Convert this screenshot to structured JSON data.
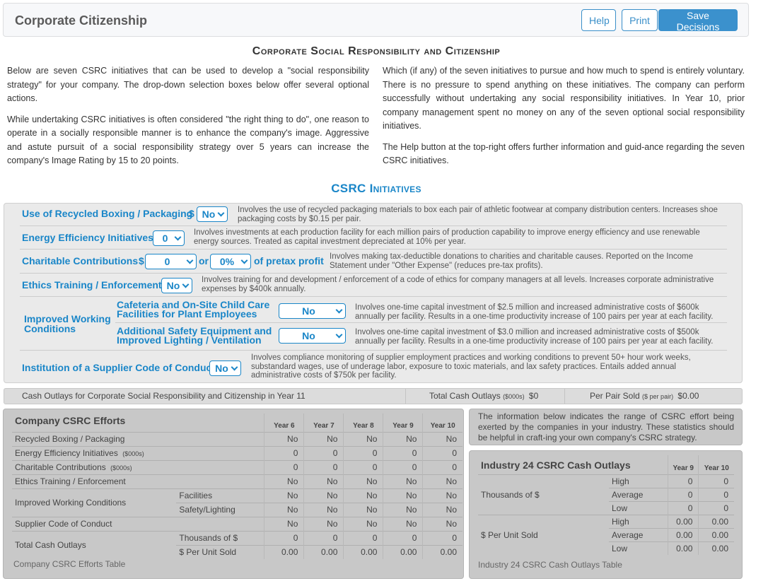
{
  "header": {
    "title": "Corporate Citizenship",
    "buttons": {
      "help": "Help",
      "print": "Print",
      "save": "Save Decisions"
    }
  },
  "main_title": "Corporate Social Responsibility and Citizenship",
  "intro": {
    "left": [
      "Below are seven CSRC initiatives that can be used to develop a \"social responsibility strategy\" for your company. The drop-down selection boxes below offer several optional actions.",
      "While undertaking CSRC initiatives is often considered \"the right thing to do\", one reason to operate in a socially responsible manner is to enhance the company's image. Aggressive and astute pursuit of a social responsibility strategy over 5 years can increase the company's Image Rating by 15 to 20 points."
    ],
    "right": [
      "Which (if any) of the seven initiatives to pursue and how much to spend is entirely voluntary. There is no pressure to spend anything on these initiatives. The company can perform successfully without undertaking any social responsibility initiatives. In Year 10, prior company management spent no money on any of the seven optional social responsibility initiatives.",
      "The Help button at the top-right offers further information and guid-ance regarding the seven CSRC initiatives."
    ]
  },
  "initiatives_title": "CSRC Initiatives",
  "initiatives": {
    "recycled": {
      "label": "Use of Recycled Boxing / Packaging",
      "prefix": "$",
      "value": "No",
      "desc": "Involves the use of recycled packaging materials to box each pair of athletic footwear at company distribution centers. Increases shoe packaging costs by $0.15 per pair."
    },
    "energy": {
      "label": "Energy Efficiency Initiatives",
      "value": "0",
      "desc": "Involves investments at each production facility for each million pairs of production capability to improve energy efficiency and use renewable energy sources. Treated as capital investment depreciated at 10% per year."
    },
    "charity": {
      "label": "Charitable Contributions",
      "prefix": "$",
      "value": "0",
      "or": "or",
      "pct_value": "0%",
      "suffix": "of pretax profit",
      "desc": "Involves making tax-deductible donations to charities and charitable causes. Reported on the Income Statement under \"Other Expense\" (reduces pre-tax profits)."
    },
    "ethics": {
      "label": "Ethics Training / Enforcement",
      "value": "No",
      "desc": "Involves training for and development / enforcement of a code of ethics for company managers at all levels. Increases corporate administrative expenses by $400k annually."
    },
    "working": {
      "label": "Improved Working Conditions",
      "cafeteria": {
        "label": "Cafeteria and On-Site Child Care Facilities for Plant Employees",
        "value": "No",
        "desc": "Involves one-time capital investment of $2.5 million and increased administrative costs of $600k annually per facility. Results in a one-time productivity increase of 100 pairs per year at each facility."
      },
      "safety": {
        "label": "Additional Safety Equipment and Improved Lighting / Ventilation",
        "value": "No",
        "desc": "Involves one-time capital investment of $3.0 million and increased administrative costs of $500k annually per facility. Results in a one-time productivity increase of 100 pairs per year at each facility."
      }
    },
    "supplier": {
      "label": "Institution of a Supplier Code of Conduct",
      "value": "No",
      "desc": "Involves compliance monitoring of supplier employment practices and working conditions to prevent 50+ hour work weeks, substandard wages, use of underage labor, exposure to toxic materials, and lax safety practices. Entails added annual administrative costs of $750k per facility."
    }
  },
  "cash_outlays": {
    "label": "Cash Outlays for Corporate Social Responsibility and Citizenship in Year 11",
    "total_label": "Total Cash Outlays",
    "total_unit": "($000s)",
    "total_value": "$0",
    "per_pair_label": "Per Pair Sold",
    "per_pair_unit": "($ per pair)",
    "per_pair_value": "$0.00"
  },
  "company_efforts": {
    "title": "Company CSRC Efforts",
    "years": [
      "Year 6",
      "Year 7",
      "Year 8",
      "Year 9",
      "Year 10"
    ],
    "rows": [
      {
        "label": "Recycled Boxing / Packaging",
        "unit": "",
        "sub": "",
        "values": [
          "No",
          "No",
          "No",
          "No",
          "No"
        ]
      },
      {
        "label": "Energy Efficiency Initiatives",
        "unit": "($000s)",
        "sub": "",
        "values": [
          "0",
          "0",
          "0",
          "0",
          "0"
        ]
      },
      {
        "label": "Charitable Contributions",
        "unit": "($000s)",
        "sub": "",
        "values": [
          "0",
          "0",
          "0",
          "0",
          "0"
        ]
      },
      {
        "label": "Ethics Training / Enforcement",
        "unit": "",
        "sub": "",
        "values": [
          "No",
          "No",
          "No",
          "No",
          "No"
        ]
      },
      {
        "label": "Improved Working Conditions",
        "unit": "",
        "sub": "Facilities",
        "values": [
          "No",
          "No",
          "No",
          "No",
          "No"
        ]
      },
      {
        "label": "",
        "unit": "",
        "sub": "Safety/Lighting",
        "values": [
          "No",
          "No",
          "No",
          "No",
          "No"
        ]
      },
      {
        "label": "Supplier Code of Conduct",
        "unit": "",
        "sub": "",
        "values": [
          "No",
          "No",
          "No",
          "No",
          "No"
        ]
      },
      {
        "label": "Total Cash Outlays",
        "unit": "",
        "sub": "Thousands of $",
        "values": [
          "0",
          "0",
          "0",
          "0",
          "0"
        ]
      },
      {
        "label": "",
        "unit": "",
        "sub": "$ Per Unit Sold",
        "values": [
          "0.00",
          "0.00",
          "0.00",
          "0.00",
          "0.00"
        ]
      }
    ],
    "caption": "Company CSRC Efforts Table"
  },
  "industry_info": "The information below indicates the range of CSRC effort being exerted by the companies in your industry. These statistics should be helpful in craft-ing your own company's CSRC strategy.",
  "industry": {
    "title": "Industry 24 CSRC Cash Outlays",
    "years": [
      "Year 9",
      "Year 10"
    ],
    "groups": [
      {
        "label": "Thousands of $",
        "rows": [
          {
            "stat": "High",
            "values": [
              "0",
              "0"
            ]
          },
          {
            "stat": "Average",
            "values": [
              "0",
              "0"
            ]
          },
          {
            "stat": "Low",
            "values": [
              "0",
              "0"
            ]
          }
        ]
      },
      {
        "label": "$ Per Unit Sold",
        "rows": [
          {
            "stat": "High",
            "values": [
              "0.00",
              "0.00"
            ]
          },
          {
            "stat": "Average",
            "values": [
              "0.00",
              "0.00"
            ]
          },
          {
            "stat": "Low",
            "values": [
              "0.00",
              "0.00"
            ]
          }
        ]
      }
    ],
    "caption": "Industry 24 CSRC Cash Outlays Table"
  }
}
